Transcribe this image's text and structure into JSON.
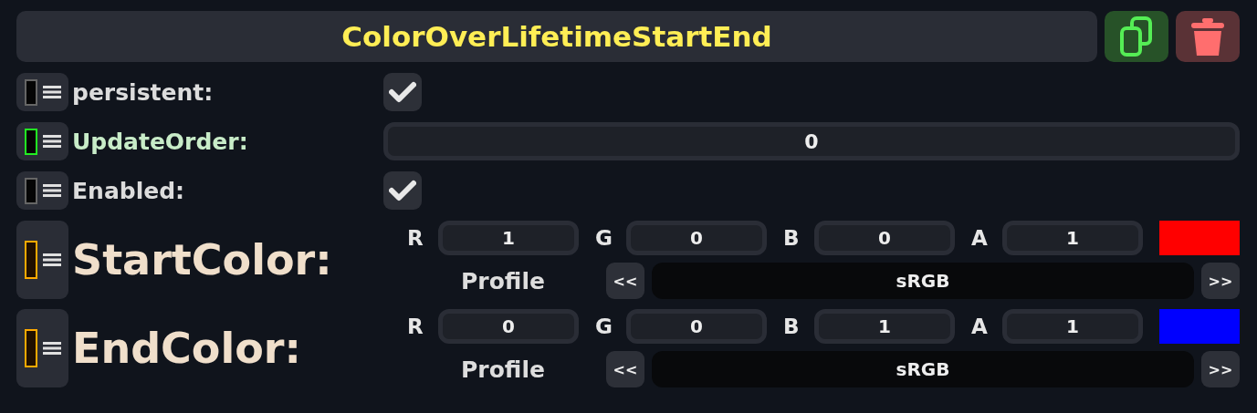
{
  "header": {
    "title": "ColorOverLifetimeStartEnd",
    "buttons": [
      {
        "kind": "duplicate"
      },
      {
        "kind": "delete"
      }
    ]
  },
  "properties": [
    {
      "kind": "checkbox",
      "label": "persistent:",
      "handle": {
        "color": "#666666"
      },
      "checked": true
    },
    {
      "kind": "number",
      "label": "UpdateOrder:",
      "handle": {
        "color": "#22ee22"
      },
      "value": "0"
    },
    {
      "kind": "checkbox",
      "label": "Enabled:",
      "handle": {
        "color": "#666666"
      },
      "checked": true
    },
    {
      "kind": "color",
      "label": "StartColor:",
      "handle": {
        "color": "#ffaa00"
      },
      "channels": [
        {
          "label": "R",
          "value": "1"
        },
        {
          "label": "G",
          "value": "0"
        },
        {
          "label": "B",
          "value": "0"
        },
        {
          "label": "A",
          "value": "1"
        }
      ],
      "swatch": {
        "color": "#ff0000"
      },
      "profile_label": "Profile",
      "prev": "<<",
      "profile": "sRGB",
      "next": ">>"
    },
    {
      "kind": "color",
      "label": "EndColor:",
      "handle": {
        "color": "#ffaa00"
      },
      "channels": [
        {
          "label": "R",
          "value": "0"
        },
        {
          "label": "G",
          "value": "0"
        },
        {
          "label": "B",
          "value": "1"
        },
        {
          "label": "A",
          "value": "1"
        }
      ],
      "swatch": {
        "color": "#0000ff"
      },
      "profile_label": "Profile",
      "prev": "<<",
      "profile": "sRGB",
      "next": ">>"
    }
  ]
}
